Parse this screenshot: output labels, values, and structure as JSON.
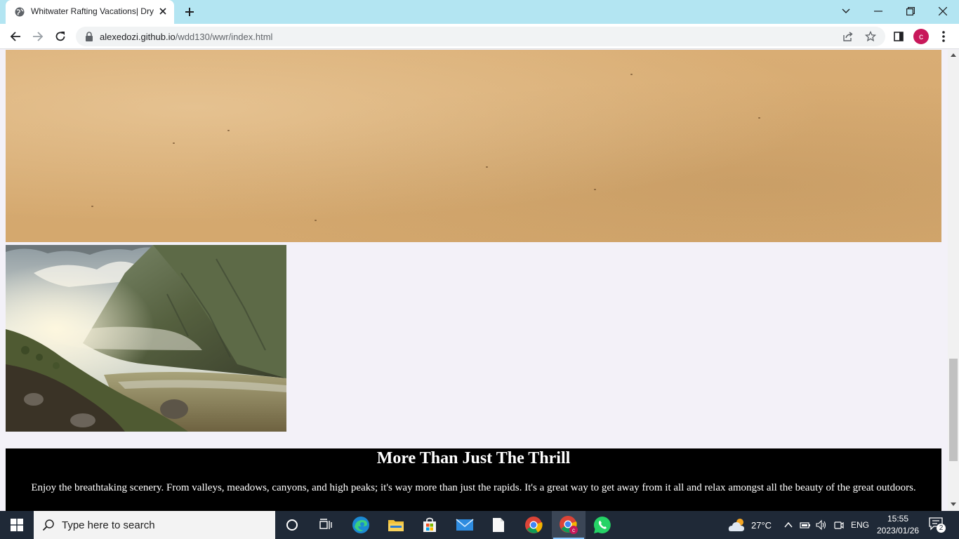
{
  "browser": {
    "tab_title": "Whitwater Rafting Vacations| Dry",
    "url_host": "alexedozi.github.io",
    "url_path": "/wdd130/wwr/index.html",
    "profile_initial": "c"
  },
  "page": {
    "thrill_heading": "More Than Just The Thrill",
    "thrill_text": "Enjoy the breathtaking scenery. From valleys, meadows, canyons, and high peaks; it's way more than just the rapids. It's a great way to get away from it all and relax amongst all the beauty of the great outdoors."
  },
  "taskbar": {
    "search_placeholder": "Type here to search",
    "temperature": "27°C",
    "language": "ENG",
    "time": "15:55",
    "date": "2023/01/26",
    "notification_count": "2"
  },
  "colors": {
    "tab_strip": "#b3e5f2",
    "paper": "#d6aa71",
    "thrill_bg": "#000000",
    "taskbar": "#1f2937",
    "avatar": "#c8185a"
  }
}
